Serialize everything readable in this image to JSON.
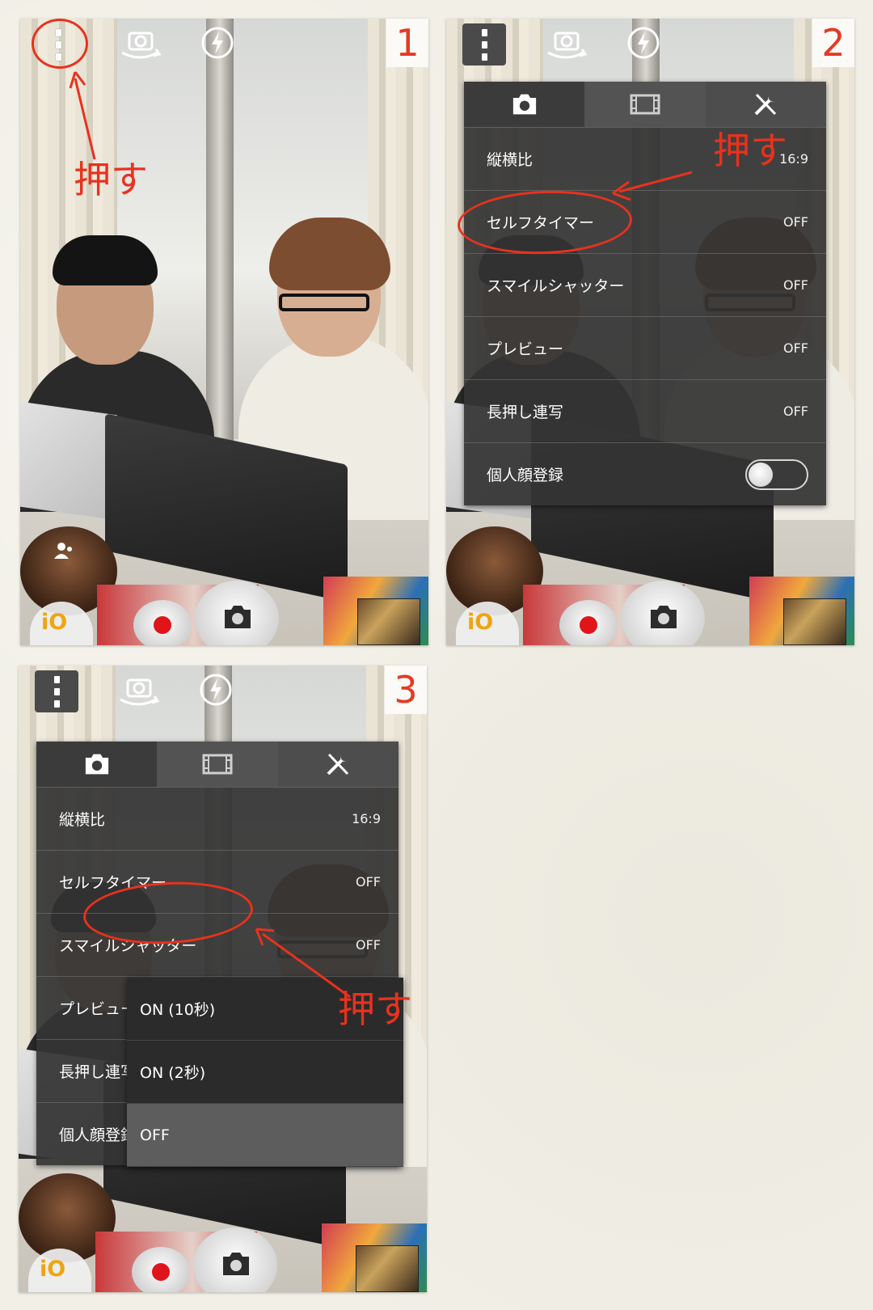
{
  "panels": [
    {
      "number": "1"
    },
    {
      "number": "2"
    },
    {
      "number": "3"
    }
  ],
  "annotations": {
    "press": "押す"
  },
  "bottom": {
    "capture_mode_label": "iO"
  },
  "menu": {
    "tabs": [
      {
        "icon": "camera-icon"
      },
      {
        "icon": "film-icon"
      },
      {
        "icon": "tools-icon"
      }
    ],
    "rows": [
      {
        "label": "縦横比",
        "value": "16:9"
      },
      {
        "label": "セルフタイマー",
        "value": "OFF"
      },
      {
        "label": "スマイルシャッター",
        "value": "OFF"
      },
      {
        "label": "プレビュー",
        "value": "OFF"
      },
      {
        "label": "長押し連写",
        "value": "OFF"
      },
      {
        "label": "個人顔登録",
        "toggle": false
      }
    ]
  },
  "timer_popup": {
    "options": [
      "ON (10秒)",
      "ON (2秒)",
      "OFF"
    ],
    "selected": "OFF"
  },
  "colors": {
    "annotation": "#e8321d",
    "record": "#e0141b",
    "capture_mode": "#f0a412"
  }
}
